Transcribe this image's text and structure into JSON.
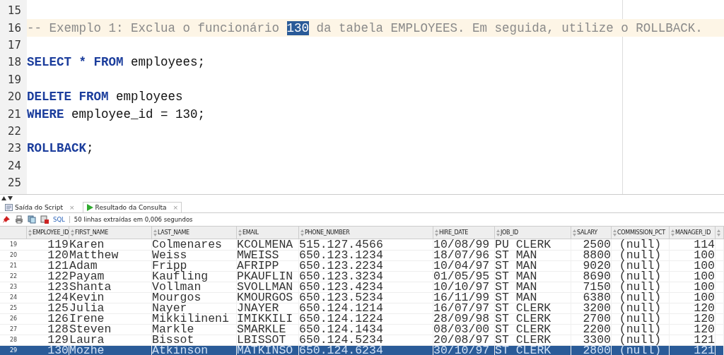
{
  "editor": {
    "lines": [
      {
        "number": "15",
        "current": false
      },
      {
        "number": "16",
        "current": true,
        "segments": [
          {
            "kind": "comment",
            "text": "-- Exemplo 1: Exclua o funcionário "
          },
          {
            "kind": "selection",
            "text": "130"
          },
          {
            "kind": "comment",
            "text": " da tabela EMPLOYEES. Em seguida, utilize o ROLLBACK."
          }
        ]
      },
      {
        "number": "17",
        "current": false
      },
      {
        "number": "18",
        "current": false,
        "segments": [
          {
            "kind": "keyword",
            "text": "SELECT * FROM"
          },
          {
            "kind": "plain",
            "text": " employees;"
          }
        ]
      },
      {
        "number": "19",
        "current": false
      },
      {
        "number": "20",
        "current": false,
        "segments": [
          {
            "kind": "keyword",
            "text": "DELETE FROM"
          },
          {
            "kind": "plain",
            "text": " employees"
          }
        ]
      },
      {
        "number": "21",
        "current": false,
        "segments": [
          {
            "kind": "keyword",
            "text": "WHERE"
          },
          {
            "kind": "plain",
            "text": " employee_id = 130;"
          }
        ]
      },
      {
        "number": "22",
        "current": false
      },
      {
        "number": "23",
        "current": false,
        "segments": [
          {
            "kind": "keyword",
            "text": "ROLLBACK"
          },
          {
            "kind": "plain",
            "text": ";"
          }
        ]
      },
      {
        "number": "24",
        "current": false
      },
      {
        "number": "25",
        "current": false
      }
    ]
  },
  "tabs": [
    {
      "label": "Saída do Script",
      "close": "×",
      "selected": false,
      "kind": "script"
    },
    {
      "label": "Resultado da Consulta",
      "close": "×",
      "selected": true,
      "kind": "run"
    }
  ],
  "toolbar": {
    "sql": "SQL",
    "status": "50 linhas extraídas em 0,006 segundos"
  },
  "table": {
    "columns": [
      "EMPLOYEE_ID",
      "FIRST_NAME",
      "LAST_NAME",
      "EMAIL",
      "PHONE_NUMBER",
      "HIRE_DATE",
      "JOB_ID",
      "SALARY",
      "COMMISSION_PCT",
      "MANAGER_ID"
    ],
    "rows": [
      {
        "number": "19",
        "selected": false,
        "cells": [
          "119",
          "Karen",
          "Colmenares",
          "KCOLMENA",
          "515.127.4566",
          "10/08/99",
          "PU CLERK",
          "2500",
          "(null)",
          "114"
        ]
      },
      {
        "number": "20",
        "selected": false,
        "cells": [
          "120",
          "Matthew",
          "Weiss",
          "MWEISS",
          "650.123.1234",
          "18/07/96",
          "ST MAN",
          "8800",
          "(null)",
          "100"
        ]
      },
      {
        "number": "21",
        "selected": false,
        "cells": [
          "121",
          "Adam",
          "Fripp",
          "AFRIPP",
          "650.123.2234",
          "10/04/97",
          "ST MAN",
          "9020",
          "(null)",
          "100"
        ]
      },
      {
        "number": "22",
        "selected": false,
        "cells": [
          "122",
          "Payam",
          "Kaufling",
          "PKAUFLIN",
          "650.123.3234",
          "01/05/95",
          "ST MAN",
          "8690",
          "(null)",
          "100"
        ]
      },
      {
        "number": "23",
        "selected": false,
        "cells": [
          "123",
          "Shanta",
          "Vollman",
          "SVOLLMAN",
          "650.123.4234",
          "10/10/97",
          "ST MAN",
          "7150",
          "(null)",
          "100"
        ]
      },
      {
        "number": "24",
        "selected": false,
        "cells": [
          "124",
          "Kevin",
          "Mourgos",
          "KMOURGOS",
          "650.123.5234",
          "16/11/99",
          "ST MAN",
          "6380",
          "(null)",
          "100"
        ]
      },
      {
        "number": "25",
        "selected": false,
        "cells": [
          "125",
          "Julia",
          "Nayer",
          "JNAYER",
          "650.124.1214",
          "16/07/97",
          "ST CLERK",
          "3200",
          "(null)",
          "120"
        ]
      },
      {
        "number": "26",
        "selected": false,
        "cells": [
          "126",
          "Irene",
          "Mikkilineni",
          "IMIKKILI",
          "650.124.1224",
          "28/09/98",
          "ST CLERK",
          "2700",
          "(null)",
          "120"
        ]
      },
      {
        "number": "27",
        "selected": false,
        "cells": [
          "128",
          "Steven",
          "Markle",
          "SMARKLE",
          "650.124.1434",
          "08/03/00",
          "ST CLERK",
          "2200",
          "(null)",
          "120"
        ]
      },
      {
        "number": "28",
        "selected": false,
        "cells": [
          "129",
          "Laura",
          "Bissot",
          "LBISSOT",
          "650.124.5234",
          "20/08/97",
          "ST CLERK",
          "3300",
          "(null)",
          "121"
        ]
      },
      {
        "number": "29",
        "selected": true,
        "cells": [
          "130",
          "Mozhe",
          "Atkinson",
          "MATKINSO",
          "650.124.6234",
          "30/10/97",
          "ST CLERK",
          "2800",
          "(null)",
          "121"
        ]
      }
    ]
  }
}
